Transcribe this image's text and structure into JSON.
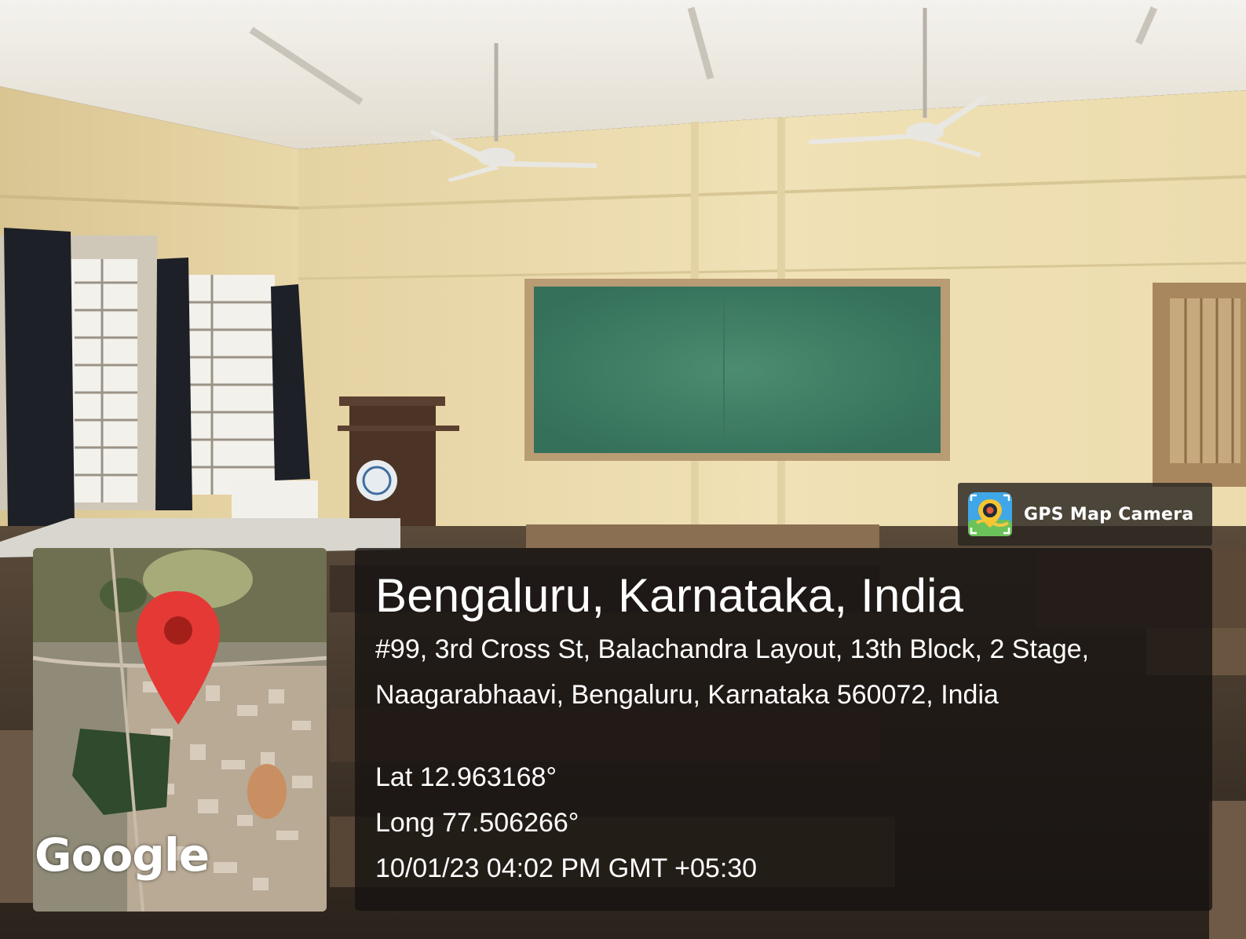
{
  "app_badge": {
    "name": "GPS Map Camera",
    "icon": "gps-map-camera-icon"
  },
  "map": {
    "brand": "Google",
    "pin_icon": "map-pin-icon"
  },
  "location": {
    "title": "Bengaluru, Karnataka, India",
    "address": "#99, 3rd Cross St, Balachandra Layout, 13th Block, 2 Stage, Naagarabhaavi, Bengaluru, Karnataka 560072, India",
    "lat": "Lat 12.963168°",
    "long": "Long 77.506266°",
    "timestamp": "10/01/23 04:02 PM GMT +05:30"
  },
  "colors": {
    "pin": "#e53935",
    "wall": "#eedfb3",
    "board": "#3f7d62",
    "overlay": "#16130f"
  }
}
